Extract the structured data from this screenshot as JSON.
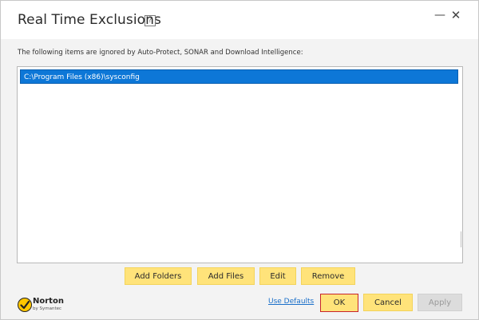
{
  "window": {
    "title": "Real Time Exclusions",
    "help_icon": "?",
    "minimize_glyph": "—",
    "close_glyph": "✕"
  },
  "description": "The following items are ignored by Auto-Protect, SONAR and Download Intelligence:",
  "exclusions": [
    "C:\\Program Files (x86)\\sysconfig"
  ],
  "buttons": {
    "add_folders": "Add Folders",
    "add_files": "Add Files",
    "edit": "Edit",
    "remove": "Remove",
    "use_defaults": "Use Defaults",
    "ok": "OK",
    "cancel": "Cancel",
    "apply": "Apply"
  },
  "logo": {
    "brand": "Norton",
    "sub": "by Symantec",
    "icon": "checkmark-shield-icon"
  },
  "colors": {
    "selection": "#0d77d7",
    "button": "#ffe37a",
    "ok_border": "#c8242b",
    "link": "#1a6fc9",
    "logo_yellow": "#ffc600"
  }
}
